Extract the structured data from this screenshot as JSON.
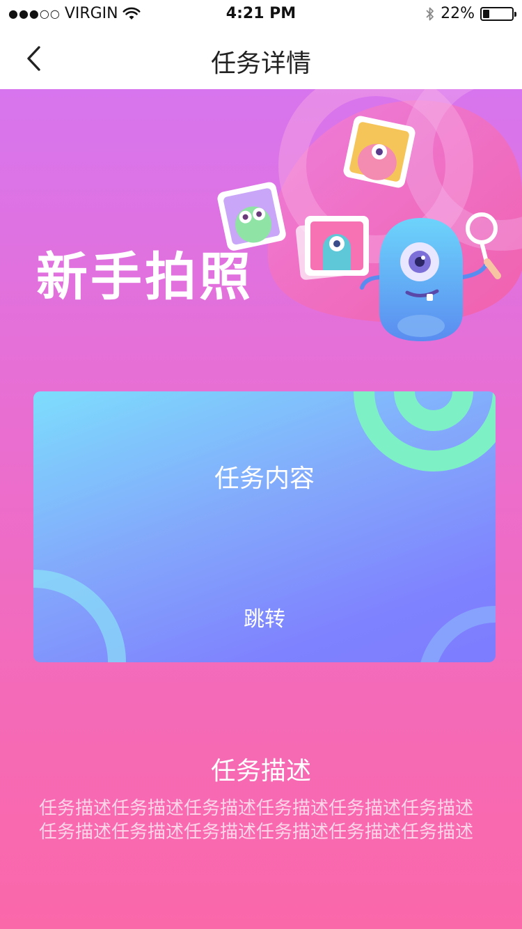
{
  "status_bar": {
    "signal_dots": "●●●○○",
    "carrier": "VIRGIN",
    "time": "4:21 PM",
    "battery_percent": "22%",
    "battery_level": 0.22
  },
  "nav": {
    "title": "任务详情",
    "back_icon": "chevron-left-icon"
  },
  "hero": {
    "title": "新手拍照"
  },
  "card": {
    "title": "任务内容",
    "link": "跳转"
  },
  "description": {
    "title": "任务描述",
    "lines": [
      "任务描述任务描述任务描述任务描述任务描述任务描述",
      "任务描述任务描述任务描述任务描述任务描述任务描述"
    ]
  },
  "colors": {
    "card_green_ring": "#7ef0c6",
    "gradient_top": "#d775ee",
    "gradient_bottom": "#fb68aa"
  }
}
